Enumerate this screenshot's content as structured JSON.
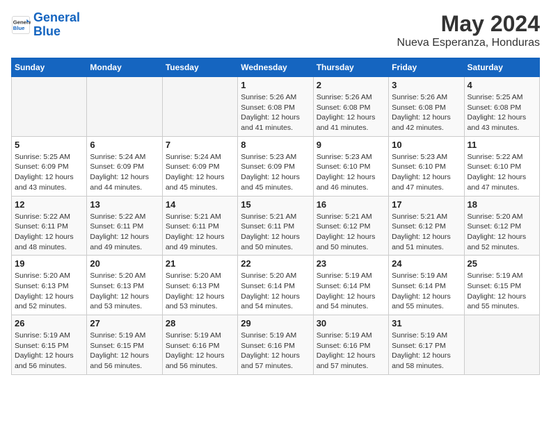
{
  "header": {
    "logo_line1": "General",
    "logo_line2": "Blue",
    "month_title": "May 2024",
    "location": "Nueva Esperanza, Honduras"
  },
  "weekdays": [
    "Sunday",
    "Monday",
    "Tuesday",
    "Wednesday",
    "Thursday",
    "Friday",
    "Saturday"
  ],
  "weeks": [
    [
      {
        "day": "",
        "info": ""
      },
      {
        "day": "",
        "info": ""
      },
      {
        "day": "",
        "info": ""
      },
      {
        "day": "1",
        "info": "Sunrise: 5:26 AM\nSunset: 6:08 PM\nDaylight: 12 hours\nand 41 minutes."
      },
      {
        "day": "2",
        "info": "Sunrise: 5:26 AM\nSunset: 6:08 PM\nDaylight: 12 hours\nand 41 minutes."
      },
      {
        "day": "3",
        "info": "Sunrise: 5:26 AM\nSunset: 6:08 PM\nDaylight: 12 hours\nand 42 minutes."
      },
      {
        "day": "4",
        "info": "Sunrise: 5:25 AM\nSunset: 6:08 PM\nDaylight: 12 hours\nand 43 minutes."
      }
    ],
    [
      {
        "day": "5",
        "info": "Sunrise: 5:25 AM\nSunset: 6:09 PM\nDaylight: 12 hours\nand 43 minutes."
      },
      {
        "day": "6",
        "info": "Sunrise: 5:24 AM\nSunset: 6:09 PM\nDaylight: 12 hours\nand 44 minutes."
      },
      {
        "day": "7",
        "info": "Sunrise: 5:24 AM\nSunset: 6:09 PM\nDaylight: 12 hours\nand 45 minutes."
      },
      {
        "day": "8",
        "info": "Sunrise: 5:23 AM\nSunset: 6:09 PM\nDaylight: 12 hours\nand 45 minutes."
      },
      {
        "day": "9",
        "info": "Sunrise: 5:23 AM\nSunset: 6:10 PM\nDaylight: 12 hours\nand 46 minutes."
      },
      {
        "day": "10",
        "info": "Sunrise: 5:23 AM\nSunset: 6:10 PM\nDaylight: 12 hours\nand 47 minutes."
      },
      {
        "day": "11",
        "info": "Sunrise: 5:22 AM\nSunset: 6:10 PM\nDaylight: 12 hours\nand 47 minutes."
      }
    ],
    [
      {
        "day": "12",
        "info": "Sunrise: 5:22 AM\nSunset: 6:11 PM\nDaylight: 12 hours\nand 48 minutes."
      },
      {
        "day": "13",
        "info": "Sunrise: 5:22 AM\nSunset: 6:11 PM\nDaylight: 12 hours\nand 49 minutes."
      },
      {
        "day": "14",
        "info": "Sunrise: 5:21 AM\nSunset: 6:11 PM\nDaylight: 12 hours\nand 49 minutes."
      },
      {
        "day": "15",
        "info": "Sunrise: 5:21 AM\nSunset: 6:11 PM\nDaylight: 12 hours\nand 50 minutes."
      },
      {
        "day": "16",
        "info": "Sunrise: 5:21 AM\nSunset: 6:12 PM\nDaylight: 12 hours\nand 50 minutes."
      },
      {
        "day": "17",
        "info": "Sunrise: 5:21 AM\nSunset: 6:12 PM\nDaylight: 12 hours\nand 51 minutes."
      },
      {
        "day": "18",
        "info": "Sunrise: 5:20 AM\nSunset: 6:12 PM\nDaylight: 12 hours\nand 52 minutes."
      }
    ],
    [
      {
        "day": "19",
        "info": "Sunrise: 5:20 AM\nSunset: 6:13 PM\nDaylight: 12 hours\nand 52 minutes."
      },
      {
        "day": "20",
        "info": "Sunrise: 5:20 AM\nSunset: 6:13 PM\nDaylight: 12 hours\nand 53 minutes."
      },
      {
        "day": "21",
        "info": "Sunrise: 5:20 AM\nSunset: 6:13 PM\nDaylight: 12 hours\nand 53 minutes."
      },
      {
        "day": "22",
        "info": "Sunrise: 5:20 AM\nSunset: 6:14 PM\nDaylight: 12 hours\nand 54 minutes."
      },
      {
        "day": "23",
        "info": "Sunrise: 5:19 AM\nSunset: 6:14 PM\nDaylight: 12 hours\nand 54 minutes."
      },
      {
        "day": "24",
        "info": "Sunrise: 5:19 AM\nSunset: 6:14 PM\nDaylight: 12 hours\nand 55 minutes."
      },
      {
        "day": "25",
        "info": "Sunrise: 5:19 AM\nSunset: 6:15 PM\nDaylight: 12 hours\nand 55 minutes."
      }
    ],
    [
      {
        "day": "26",
        "info": "Sunrise: 5:19 AM\nSunset: 6:15 PM\nDaylight: 12 hours\nand 56 minutes."
      },
      {
        "day": "27",
        "info": "Sunrise: 5:19 AM\nSunset: 6:15 PM\nDaylight: 12 hours\nand 56 minutes."
      },
      {
        "day": "28",
        "info": "Sunrise: 5:19 AM\nSunset: 6:16 PM\nDaylight: 12 hours\nand 56 minutes."
      },
      {
        "day": "29",
        "info": "Sunrise: 5:19 AM\nSunset: 6:16 PM\nDaylight: 12 hours\nand 57 minutes."
      },
      {
        "day": "30",
        "info": "Sunrise: 5:19 AM\nSunset: 6:16 PM\nDaylight: 12 hours\nand 57 minutes."
      },
      {
        "day": "31",
        "info": "Sunrise: 5:19 AM\nSunset: 6:17 PM\nDaylight: 12 hours\nand 58 minutes."
      },
      {
        "day": "",
        "info": ""
      }
    ]
  ]
}
